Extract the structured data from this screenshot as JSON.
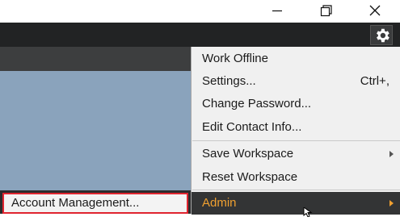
{
  "window": {
    "minimize_icon": "minimize-icon",
    "maximize_icon": "restore-icon",
    "close_icon": "close-icon"
  },
  "toolbar": {
    "settings_icon": "gear-icon"
  },
  "menu": {
    "items": [
      {
        "label": "Work Offline",
        "shortcut": ""
      },
      {
        "label": "Settings...",
        "shortcut": "Ctrl+,"
      },
      {
        "label": "Change Password...",
        "shortcut": ""
      },
      {
        "label": "Edit Contact Info...",
        "shortcut": ""
      },
      {
        "label": "Save Workspace",
        "shortcut": "",
        "submenu": true
      },
      {
        "label": "Reset Workspace",
        "shortcut": ""
      },
      {
        "label": "Admin",
        "shortcut": "",
        "submenu": true,
        "active": true
      }
    ]
  },
  "submenu": {
    "items": [
      {
        "label": "Account Management...",
        "highlighted": true
      }
    ]
  },
  "colors": {
    "toolbar_bg": "#222324",
    "content_bg": "#8aa3bc",
    "menu_bg": "#f0f0f0",
    "active_item_bg": "#333435",
    "active_item_text": "#f0a030",
    "highlight_border": "#e0242f"
  }
}
